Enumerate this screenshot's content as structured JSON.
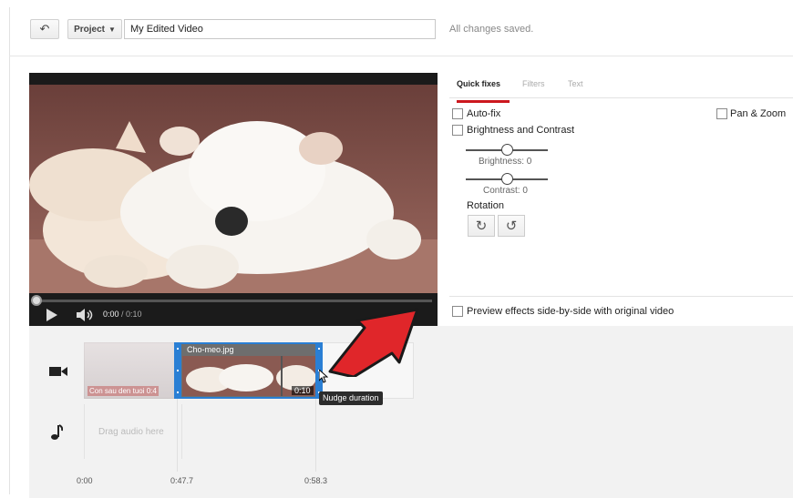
{
  "toolbar": {
    "undo_icon": "undo-arrow-icon",
    "project_label": "Project",
    "project_caret": "▼",
    "title_value": "My Edited Video",
    "save_status": "All changes saved."
  },
  "player": {
    "time_current": "0:00",
    "time_separator": " / ",
    "time_total": "0:10",
    "progress_fraction": 0.0
  },
  "effects_panel": {
    "tabs": [
      {
        "label": "Quick fixes",
        "active": true
      },
      {
        "label": "Filters",
        "active": false
      },
      {
        "label": "Text",
        "active": false
      }
    ],
    "autofix_label": "Auto-fix",
    "brightness_contrast_label": "Brightness and Contrast",
    "pan_zoom_label": "Pan & Zoom",
    "brightness_label": "Brightness: 0",
    "brightness_value": 0,
    "contrast_label": "Contrast: 0",
    "contrast_value": 0,
    "rotation_label": "Rotation",
    "rotate_cw_icon": "↻",
    "rotate_ccw_icon": "↺",
    "preview_label": "Preview effects side-by-side with original video"
  },
  "timeline": {
    "faded_clip_label": "Con sau den tuoi",
    "faded_clip_duration": "0:4",
    "selected_clip_name": "Cho-meo.jpg",
    "selected_clip_duration": "0:10",
    "audio_drop_label": "Drag audio here",
    "tooltip": "Nudge duration",
    "ruler": [
      "0:00",
      "0:47.7",
      "0:58.3"
    ]
  },
  "colors": {
    "accent_red": "#cc181e",
    "selection_blue": "#2a7fd4",
    "annotation_arrow": "#e0262a"
  }
}
